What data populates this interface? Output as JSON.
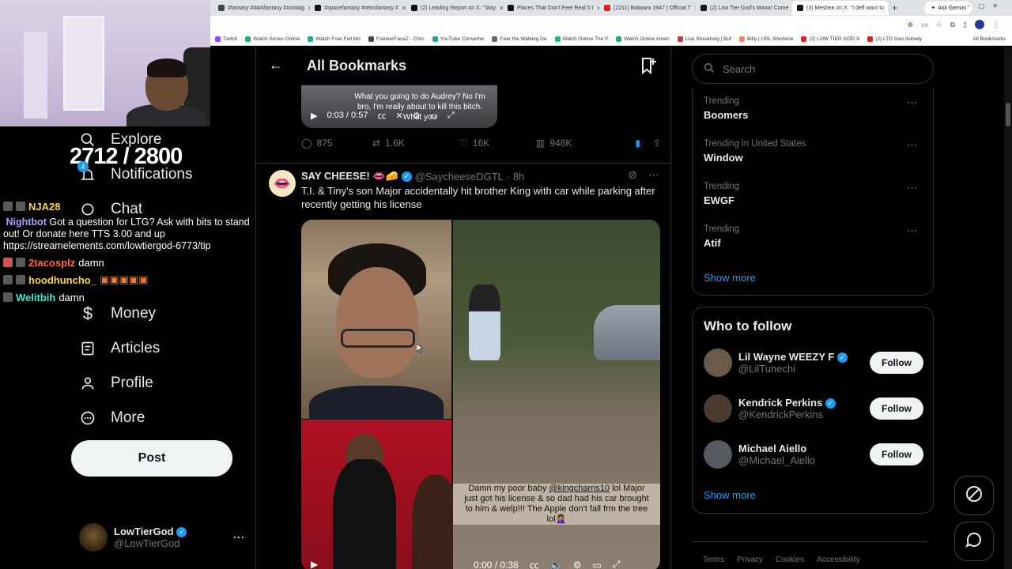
{
  "browser": {
    "tabs": [
      {
        "label": "#fantasy #darkfantasy #nostalg",
        "color": "#444"
      },
      {
        "label": "#spacefantasy #retrofantasy #",
        "color": "#111"
      },
      {
        "label": "(2) Leading Report on X: \"Stay",
        "color": "#111"
      },
      {
        "label": "Places That Don't Feel Real 5 t",
        "color": "#111"
      },
      {
        "label": "(2211) Batwara 1947 | Official T",
        "color": "#e02020"
      },
      {
        "label": "(2) Low Tier God's Manor Come",
        "color": "#111"
      },
      {
        "label": "(3) Meshea on X: \"I deff want to",
        "color": "#111"
      }
    ],
    "gemini_label": "Ask Gemini",
    "bookmarks": [
      {
        "label": "Twitch",
        "color": "#9146ff"
      },
      {
        "label": "Watch Series Online",
        "color": "#2a7"
      },
      {
        "label": "Watch Free Full Mo",
        "color": "#2a9"
      },
      {
        "label": "FrankerFaceZ - Chro",
        "color": "#444"
      },
      {
        "label": "YouTube Converter",
        "color": "#2a8"
      },
      {
        "label": "Fear the Walking De",
        "color": "#666"
      },
      {
        "label": "Watch Online The P",
        "color": "#2b8"
      },
      {
        "label": "Watch Online Ameri",
        "color": "#2a7"
      },
      {
        "label": "Live Streaming | Buf",
        "color": "#c33"
      },
      {
        "label": "Bitly | URL Shortene",
        "color": "#e86"
      },
      {
        "label": "(2) LOW TIER GOD S",
        "color": "#e02020"
      },
      {
        "label": "(2) LTG tries itslowly",
        "color": "#e02020"
      }
    ],
    "all_bookmarks": "All Bookmarks"
  },
  "overlay": {
    "counter": "2712 / 2800",
    "chat": [
      {
        "user": "NJA28",
        "color": "#ffd54a",
        "text": ""
      },
      {
        "user": "Nightbot",
        "color": "#b59cff",
        "text": "Got a question for LTG? Ask with bits to stand out! Or donate here TTS 3.00 and up https://streamelements.com/lowtiergod-6773/tip"
      },
      {
        "user": "2tacosplz",
        "color": "#ff6a3d",
        "text": "damn"
      },
      {
        "user": "hoodhuncho_",
        "color": "#ffd54a",
        "text": ""
      },
      {
        "user": "Welitbih",
        "color": "#4be3c8",
        "text": "damn"
      }
    ]
  },
  "nav": {
    "explore": "Explore",
    "notifications": "Notifications",
    "notif_count": "4",
    "chat": "Chat",
    "money": "Money",
    "articles": "Articles",
    "profile": "Profile",
    "more": "More",
    "post": "Post",
    "account": {
      "name": "LowTierGod",
      "handle": "@LowTierGod"
    }
  },
  "main": {
    "title": "All Bookmarks",
    "video1": {
      "subtitle": "What you going to do Audrey? No I'm bro, I'm really about to kill this bitch. What you",
      "time": "0:03 / 0:57"
    },
    "actions": {
      "replies": "875",
      "reposts": "1.6K",
      "likes": "16K",
      "views": "946K"
    },
    "tweet": {
      "name": "SAY CHEESE! 👄🧀",
      "handle": "@SaycheeseDGTL",
      "time": "· 8h",
      "text": "T.I. & Tiny's son Major accidentally hit brother King with car while parking after recently getting his license",
      "caption_pre": "Damn my poor baby ",
      "caption_link": "@kingcharris10",
      "caption_post": " lol Major just got his license & so dad had his car brought to him & welp!!! The Apple don't fall frm the tree lol🤦🏽‍♀️",
      "video_time": "0:00 / 0:38"
    }
  },
  "sidebar": {
    "search_placeholder": "Search",
    "trends": [
      {
        "category": "Trending",
        "title": "Boomers"
      },
      {
        "category": "Trending in United States",
        "title": "Window"
      },
      {
        "category": "Trending",
        "title": "EWGF"
      },
      {
        "category": "Trending",
        "title": "Atif"
      }
    ],
    "show_more": "Show more",
    "who_to_follow": "Who to follow",
    "follow_label": "Follow",
    "suggestions": [
      {
        "name": "Lil Wayne WEEZY F",
        "handle": "@LilTunechi",
        "verified": true,
        "color": "#6b5a48"
      },
      {
        "name": "Kendrick Perkins",
        "handle": "@KendrickPerkins",
        "verified": true,
        "color": "#4a3a30"
      },
      {
        "name": "Michael Aiello",
        "handle": "@Michael_Aiello",
        "verified": false,
        "color": "#555a60"
      }
    ],
    "footer": [
      "Terms",
      "Privacy",
      "Cookies",
      "Accessibility"
    ]
  }
}
